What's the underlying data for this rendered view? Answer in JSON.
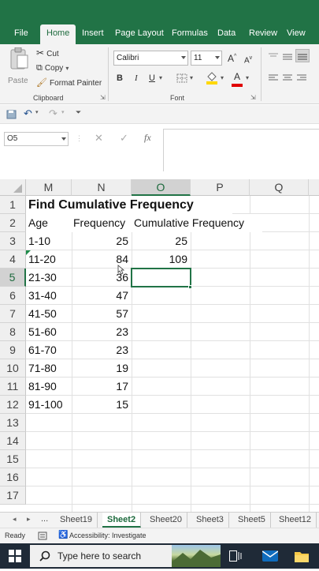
{
  "ribbon": {
    "tabs": [
      "File",
      "Home",
      "Insert",
      "Page Layout",
      "Formulas",
      "Data",
      "Review",
      "View"
    ],
    "active_tab": "Home",
    "clipboard": {
      "paste_label": "Paste",
      "cut_label": "Cut",
      "copy_label": "Copy",
      "format_painter_label": "Format Painter",
      "group_label": "Clipboard"
    },
    "font": {
      "font_name": "Calibri",
      "font_size": "11",
      "bold": "B",
      "italic": "I",
      "underline": "U",
      "grow": "A",
      "shrink": "A",
      "font_color_glyph": "A",
      "group_label": "Font"
    }
  },
  "formula_bar": {
    "name_box": "O5",
    "cancel_glyph": "✕",
    "enter_glyph": "✓",
    "fx_glyph": "fx",
    "value": ""
  },
  "grid": {
    "columns": [
      "M",
      "N",
      "O",
      "P",
      "Q"
    ],
    "selected_column": "O",
    "rows": [
      "1",
      "2",
      "3",
      "4",
      "5",
      "6",
      "7",
      "8",
      "9",
      "10",
      "11",
      "12",
      "13",
      "14",
      "15",
      "16",
      "17"
    ],
    "selected_row": "5",
    "title": "Find Cumulative Frequency",
    "headers": [
      "Age",
      "Frequency",
      "Cumulative Frequency"
    ],
    "data": [
      {
        "age": "1-10",
        "frequency": "25",
        "cumulative": "25"
      },
      {
        "age": "11-20",
        "frequency": "84",
        "cumulative": "109"
      },
      {
        "age": "21-30",
        "frequency": "36",
        "cumulative": ""
      },
      {
        "age": "31-40",
        "frequency": "47",
        "cumulative": ""
      },
      {
        "age": "41-50",
        "frequency": "57",
        "cumulative": ""
      },
      {
        "age": "51-60",
        "frequency": "23",
        "cumulative": ""
      },
      {
        "age": "61-70",
        "frequency": "23",
        "cumulative": ""
      },
      {
        "age": "71-80",
        "frequency": "19",
        "cumulative": ""
      },
      {
        "age": "81-90",
        "frequency": "17",
        "cumulative": ""
      },
      {
        "age": "91-100",
        "frequency": "15",
        "cumulative": ""
      }
    ]
  },
  "sheet_tabs": {
    "ellipsis": "...",
    "tabs": [
      "Sheet19",
      "Sheet2",
      "Sheet20",
      "Sheet3",
      "Sheet5",
      "Sheet12"
    ],
    "active": "Sheet2"
  },
  "status": {
    "ready": "Ready",
    "accessibility": "Accessibility: Investigate"
  },
  "taskbar": {
    "search_placeholder": "Type here to search"
  },
  "colors": {
    "excel_green": "#217346",
    "taskbar": "#1f2a37"
  }
}
